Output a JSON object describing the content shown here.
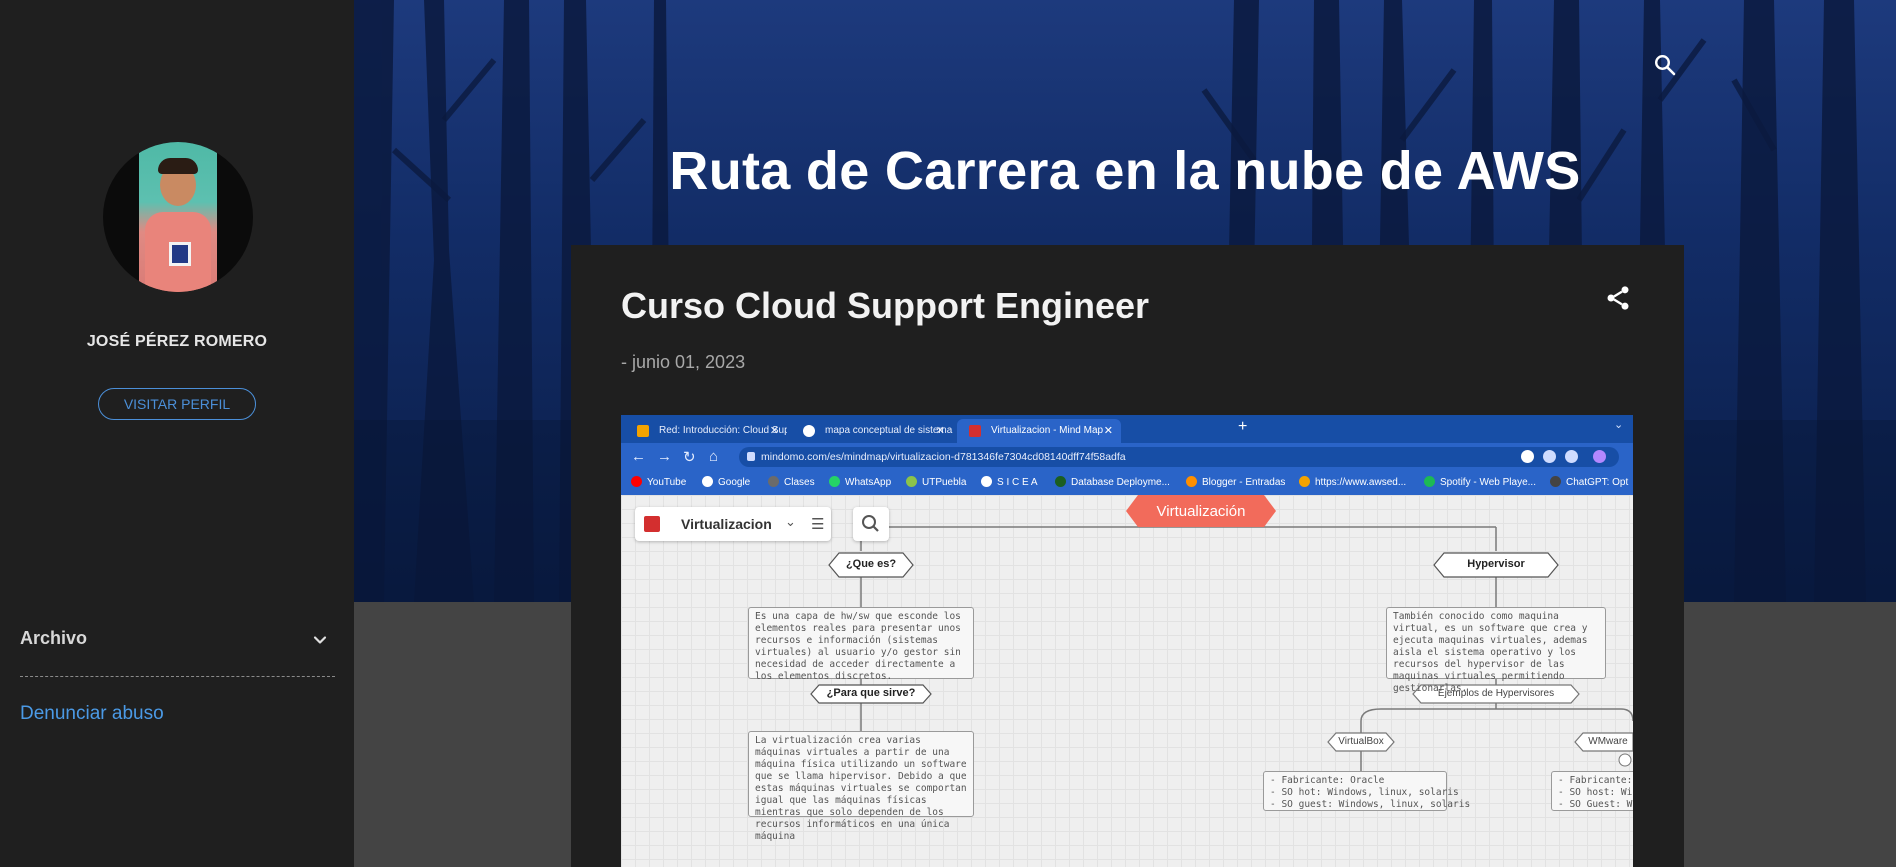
{
  "sidebar": {
    "profile_name": "JOSÉ PÉREZ ROMERO",
    "visit_profile_label": "VISITAR PERFIL",
    "archive_title": "Archivo",
    "report_abuse_label": "Denunciar abuso"
  },
  "header": {
    "blog_title": "Ruta de Carrera en la nube de AWS",
    "search_icon": "search-icon"
  },
  "post": {
    "title": "Curso Cloud Support Engineer",
    "date": "- junio 01, 2023",
    "share_icon": "share-icon"
  },
  "screenshot": {
    "tabs": [
      {
        "label": "Red: Introducción: Cloud Suppor"
      },
      {
        "label": "mapa conceptual de sistema ope"
      },
      {
        "label": "Virtualizacion - Mind Map"
      }
    ],
    "new_tab": "+",
    "tab_menu": "⌄",
    "url": "mindomo.com/es/mindmap/virtualizacion-d781346fe7304cd08140dff74f58adfa",
    "bookmarks": [
      {
        "label": "YouTube",
        "color": "#ff0000"
      },
      {
        "label": "Google",
        "color": "#ffffff"
      },
      {
        "label": "Clases",
        "color": "#6b6b6b"
      },
      {
        "label": "WhatsApp",
        "color": "#25d366"
      },
      {
        "label": "UTPuebla",
        "color": "#8bc34a"
      },
      {
        "label": "S I C E A",
        "color": "#ffffff"
      },
      {
        "label": "Database Deployme...",
        "color": "#1b5e20"
      },
      {
        "label": "Blogger - Entradas",
        "color": "#ff8f00"
      },
      {
        "label": "https://www.awsed...",
        "color": "#f4a300"
      },
      {
        "label": "Spotify - Web Playe...",
        "color": "#1db954"
      },
      {
        "label": "ChatGPT: Opt",
        "color": "#444444"
      }
    ],
    "mindmap": {
      "toolbar_title": "Virtualizacion",
      "root": "Virtualización",
      "que_es": "¿Que es?",
      "que_es_text": "Es una capa de hw/sw que esconde los elementos reales para presentar unos recursos e información (sistemas virtuales) al usuario y/o gestor sin necesidad de acceder directamente a los elementos discretos.",
      "para_que": "¿Para que sirve?",
      "para_que_text": "La virtualización crea varias máquinas virtuales a partir de una máquina física utilizando un software que se llama hipervisor. Debido a que estas máquinas virtuales se comportan igual que las máquinas físicas mientras que solo dependen de los recursos informáticos en una única máquina",
      "hypervisor": "Hypervisor",
      "hypervisor_text": "También conocido como maquina virtual, es un software que crea y ejecuta maquinas virtuales, ademas aisla el sistema operativo y los recursos del hypervisor de las maquinas virtuales permitiendo gestionarlas.",
      "examples": "Ejemplos de Hypervisores",
      "virtualbox": "VirtualBox",
      "vmware": "WMware",
      "vbox_text": "- Fabricante: Oracle\n- SO hot: Windows, linux, solaris\n- SO guest: Windows, linux, solaris",
      "vmware_text": "- Fabricante: W\n- SO host: Win\n- SO Guest: Wi"
    }
  },
  "colors": {
    "link_blue": "#4b9ae6",
    "card_bg": "#1f1f1f",
    "hero_blue": "#122c66",
    "mindmap_root": "#f26b5b"
  }
}
